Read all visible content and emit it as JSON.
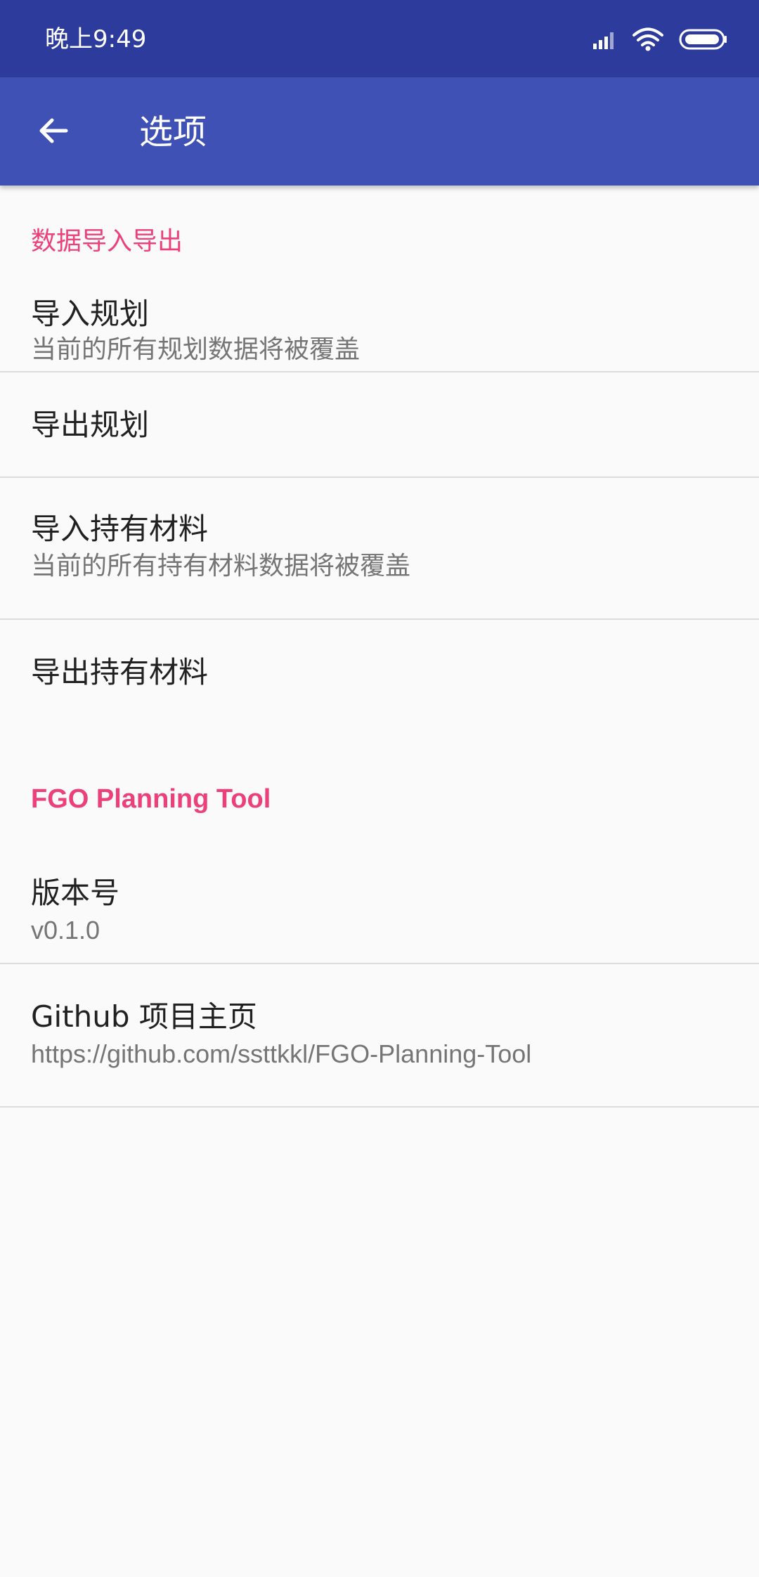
{
  "status_bar": {
    "time": "晚上9:49",
    "icons": [
      "signal-icon",
      "wifi-icon",
      "battery-icon"
    ]
  },
  "app_bar": {
    "back_icon": "arrow-back-icon",
    "title": "选项",
    "color": "#3f51b5"
  },
  "accent_color": "#ec407a",
  "sections": [
    {
      "header": "数据导入导出",
      "items": [
        {
          "title": "导入规划",
          "summary": "当前的所有规划数据将被覆盖"
        },
        {
          "title": "导出规划",
          "summary": ""
        },
        {
          "title": "导入持有材料",
          "summary": "当前的所有持有材料数据将被覆盖"
        },
        {
          "title": "导出持有材料",
          "summary": ""
        }
      ]
    },
    {
      "header": "FGO Planning Tool",
      "items": [
        {
          "title": "版本号",
          "summary": "v0.1.0"
        },
        {
          "title": "Github 项目主页",
          "summary": "https://github.com/ssttkkl/FGO-Planning-Tool"
        }
      ]
    }
  ]
}
